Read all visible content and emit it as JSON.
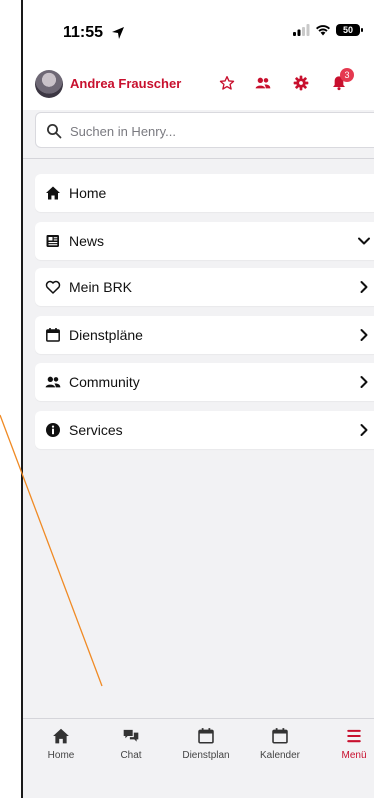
{
  "status": {
    "time": "11:55",
    "battery": "50"
  },
  "header": {
    "user_name": "Andrea Frauscher",
    "notification_count": "3"
  },
  "search": {
    "placeholder": "Suchen in Henry..."
  },
  "menu": {
    "items": [
      {
        "label": "Home",
        "icon": "home-icon",
        "chevron": "none"
      },
      {
        "label": "News",
        "icon": "newspaper-icon",
        "chevron": "down"
      },
      {
        "label": "Mein BRK",
        "icon": "heart-icon",
        "chevron": "right"
      },
      {
        "label": "Dienstpläne",
        "icon": "calendar-icon",
        "chevron": "right"
      },
      {
        "label": "Community",
        "icon": "users-icon",
        "chevron": "right"
      },
      {
        "label": "Services",
        "icon": "info-icon",
        "chevron": "right"
      }
    ]
  },
  "tabbar": {
    "tabs": [
      {
        "label": "Home",
        "icon": "home-icon"
      },
      {
        "label": "Chat",
        "icon": "chat-icon"
      },
      {
        "label": "Dienstplan",
        "icon": "calendar-icon"
      },
      {
        "label": "Kalender",
        "icon": "calendar-icon"
      },
      {
        "label": "Menü",
        "icon": "menu-icon",
        "active": true
      }
    ]
  },
  "colors": {
    "brand_red": "#c8102e",
    "background": "#f2f2f4",
    "annotation_line": "#f08a24"
  }
}
